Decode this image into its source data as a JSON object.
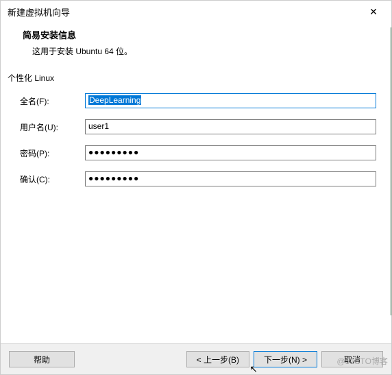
{
  "titlebar": {
    "title": "新建虚拟机向导",
    "close": "✕"
  },
  "header": {
    "title": "简易安装信息",
    "desc": "这用于安装 Ubuntu 64 位。"
  },
  "section": {
    "label": "个性化 Linux"
  },
  "form": {
    "fullname": {
      "label": "全名(F):",
      "value": "DeepLearning"
    },
    "username": {
      "label": "用户名(U):",
      "value": "user1"
    },
    "password": {
      "label": "密码(P):",
      "value": "●●●●●●●●●"
    },
    "confirm": {
      "label": "确认(C):",
      "value": "●●●●●●●●●"
    }
  },
  "footer": {
    "help": "帮助",
    "back": "< 上一步(B)",
    "next": "下一步(N) >",
    "cancel": "取消"
  },
  "watermark": "@51CTO博客"
}
